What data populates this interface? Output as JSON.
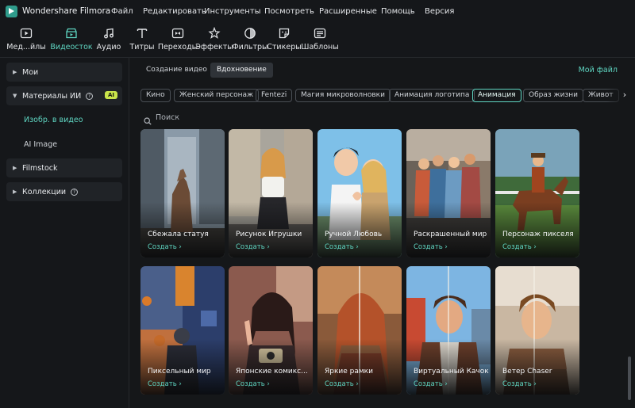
{
  "app": {
    "title": "Wondershare Filmora"
  },
  "menu": [
    "Файл",
    "Редактировать",
    "Инструменты",
    "Посмотреть",
    "Расширенные",
    "Помощь",
    "Версия"
  ],
  "toolbar": {
    "items": [
      {
        "label": "Мед...йлы",
        "icon": "media-icon"
      },
      {
        "label": "Видеосток",
        "icon": "stock-video-icon",
        "active": true
      },
      {
        "label": "Аудио",
        "icon": "audio-icon"
      },
      {
        "label": "Титры",
        "icon": "titles-icon"
      },
      {
        "label": "Переходы",
        "icon": "transitions-icon"
      },
      {
        "label": "Эффекты",
        "icon": "effects-icon"
      },
      {
        "label": "Фильтры",
        "icon": "filters-icon"
      },
      {
        "label": "Стикеры",
        "icon": "stickers-icon"
      },
      {
        "label": "Шаблоны",
        "icon": "templates-icon"
      }
    ]
  },
  "sidebar": {
    "groups": [
      {
        "label": "Мои"
      },
      {
        "label": "Материалы ИИ",
        "badge": "AI"
      },
      {
        "label": "Filmstock"
      },
      {
        "label": "Коллекции"
      }
    ],
    "ai_children": [
      {
        "label": "Изобр. в видео",
        "active": true
      },
      {
        "label": "AI Image"
      }
    ]
  },
  "main": {
    "tabs": [
      "Создание видео",
      "Вдохновение"
    ],
    "active_tab": "Вдохновение",
    "my_file": "Мой файл",
    "chips": [
      "Кино",
      "Женский персонаж",
      "Fentezi",
      "Магия микроволновки",
      "Анимация логотипа",
      "Анимация",
      "Образ жизни",
      "Живот"
    ],
    "active_chip": "Анимация",
    "search": {
      "placeholder": "Поиск"
    },
    "create_label": "Создать  ›",
    "cards": [
      {
        "title": "Сбежала статуя"
      },
      {
        "title": "Рисунок Игрушки"
      },
      {
        "title": "Ручной Любовь"
      },
      {
        "title": "Раскрашенный мир"
      },
      {
        "title": "Персонаж пикселя"
      },
      {
        "title": "Пиксельный мир"
      },
      {
        "title": "Японские комикс..."
      },
      {
        "title": "Яркие рамки"
      },
      {
        "title": "Виртуальный Качок"
      },
      {
        "title": "Ветер Chaser"
      }
    ]
  },
  "colors": {
    "accent": "#5fd6c2",
    "background": "#151719",
    "panel": "#202327",
    "ai_badge": "#c9e44a"
  }
}
